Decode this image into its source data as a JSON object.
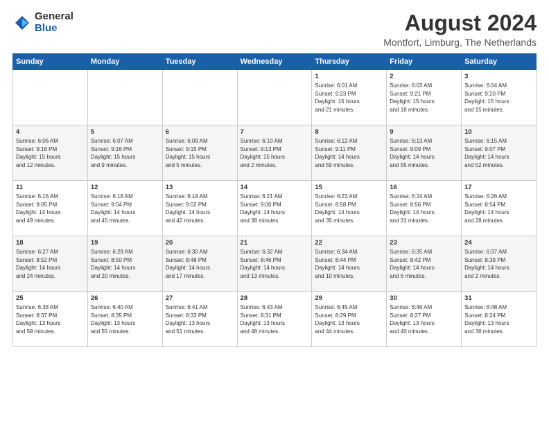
{
  "logo": {
    "general": "General",
    "blue": "Blue"
  },
  "title": "August 2024",
  "subtitle": "Montfort, Limburg, The Netherlands",
  "weekdays": [
    "Sunday",
    "Monday",
    "Tuesday",
    "Wednesday",
    "Thursday",
    "Friday",
    "Saturday"
  ],
  "weeks": [
    [
      {
        "day": "",
        "info": ""
      },
      {
        "day": "",
        "info": ""
      },
      {
        "day": "",
        "info": ""
      },
      {
        "day": "",
        "info": ""
      },
      {
        "day": "1",
        "info": "Sunrise: 6:01 AM\nSunset: 9:23 PM\nDaylight: 15 hours\nand 21 minutes."
      },
      {
        "day": "2",
        "info": "Sunrise: 6:03 AM\nSunset: 9:21 PM\nDaylight: 15 hours\nand 18 minutes."
      },
      {
        "day": "3",
        "info": "Sunrise: 6:04 AM\nSunset: 9:20 PM\nDaylight: 15 hours\nand 15 minutes."
      }
    ],
    [
      {
        "day": "4",
        "info": "Sunrise: 6:06 AM\nSunset: 9:18 PM\nDaylight: 15 hours\nand 12 minutes."
      },
      {
        "day": "5",
        "info": "Sunrise: 6:07 AM\nSunset: 9:16 PM\nDaylight: 15 hours\nand 9 minutes."
      },
      {
        "day": "6",
        "info": "Sunrise: 6:09 AM\nSunset: 9:15 PM\nDaylight: 15 hours\nand 5 minutes."
      },
      {
        "day": "7",
        "info": "Sunrise: 6:10 AM\nSunset: 9:13 PM\nDaylight: 15 hours\nand 2 minutes."
      },
      {
        "day": "8",
        "info": "Sunrise: 6:12 AM\nSunset: 9:11 PM\nDaylight: 14 hours\nand 59 minutes."
      },
      {
        "day": "9",
        "info": "Sunrise: 6:13 AM\nSunset: 9:09 PM\nDaylight: 14 hours\nand 55 minutes."
      },
      {
        "day": "10",
        "info": "Sunrise: 6:15 AM\nSunset: 9:07 PM\nDaylight: 14 hours\nand 52 minutes."
      }
    ],
    [
      {
        "day": "11",
        "info": "Sunrise: 6:16 AM\nSunset: 9:05 PM\nDaylight: 14 hours\nand 49 minutes."
      },
      {
        "day": "12",
        "info": "Sunrise: 6:18 AM\nSunset: 9:04 PM\nDaylight: 14 hours\nand 45 minutes."
      },
      {
        "day": "13",
        "info": "Sunrise: 6:19 AM\nSunset: 9:02 PM\nDaylight: 14 hours\nand 42 minutes."
      },
      {
        "day": "14",
        "info": "Sunrise: 6:21 AM\nSunset: 9:00 PM\nDaylight: 14 hours\nand 38 minutes."
      },
      {
        "day": "15",
        "info": "Sunrise: 6:23 AM\nSunset: 8:58 PM\nDaylight: 14 hours\nand 35 minutes."
      },
      {
        "day": "16",
        "info": "Sunrise: 6:24 AM\nSunset: 8:56 PM\nDaylight: 14 hours\nand 31 minutes."
      },
      {
        "day": "17",
        "info": "Sunrise: 6:26 AM\nSunset: 8:54 PM\nDaylight: 14 hours\nand 28 minutes."
      }
    ],
    [
      {
        "day": "18",
        "info": "Sunrise: 6:27 AM\nSunset: 8:52 PM\nDaylight: 14 hours\nand 24 minutes."
      },
      {
        "day": "19",
        "info": "Sunrise: 6:29 AM\nSunset: 8:50 PM\nDaylight: 14 hours\nand 20 minutes."
      },
      {
        "day": "20",
        "info": "Sunrise: 6:30 AM\nSunset: 8:48 PM\nDaylight: 14 hours\nand 17 minutes."
      },
      {
        "day": "21",
        "info": "Sunrise: 6:32 AM\nSunset: 8:46 PM\nDaylight: 14 hours\nand 13 minutes."
      },
      {
        "day": "22",
        "info": "Sunrise: 6:34 AM\nSunset: 8:44 PM\nDaylight: 14 hours\nand 10 minutes."
      },
      {
        "day": "23",
        "info": "Sunrise: 6:35 AM\nSunset: 8:42 PM\nDaylight: 14 hours\nand 6 minutes."
      },
      {
        "day": "24",
        "info": "Sunrise: 6:37 AM\nSunset: 8:39 PM\nDaylight: 14 hours\nand 2 minutes."
      }
    ],
    [
      {
        "day": "25",
        "info": "Sunrise: 6:38 AM\nSunset: 8:37 PM\nDaylight: 13 hours\nand 59 minutes."
      },
      {
        "day": "26",
        "info": "Sunrise: 6:40 AM\nSunset: 8:35 PM\nDaylight: 13 hours\nand 55 minutes."
      },
      {
        "day": "27",
        "info": "Sunrise: 6:41 AM\nSunset: 8:33 PM\nDaylight: 13 hours\nand 51 minutes."
      },
      {
        "day": "28",
        "info": "Sunrise: 6:43 AM\nSunset: 8:31 PM\nDaylight: 13 hours\nand 48 minutes."
      },
      {
        "day": "29",
        "info": "Sunrise: 6:45 AM\nSunset: 8:29 PM\nDaylight: 13 hours\nand 44 minutes."
      },
      {
        "day": "30",
        "info": "Sunrise: 6:46 AM\nSunset: 8:27 PM\nDaylight: 13 hours\nand 40 minutes."
      },
      {
        "day": "31",
        "info": "Sunrise: 6:48 AM\nSunset: 8:24 PM\nDaylight: 13 hours\nand 36 minutes."
      }
    ]
  ]
}
